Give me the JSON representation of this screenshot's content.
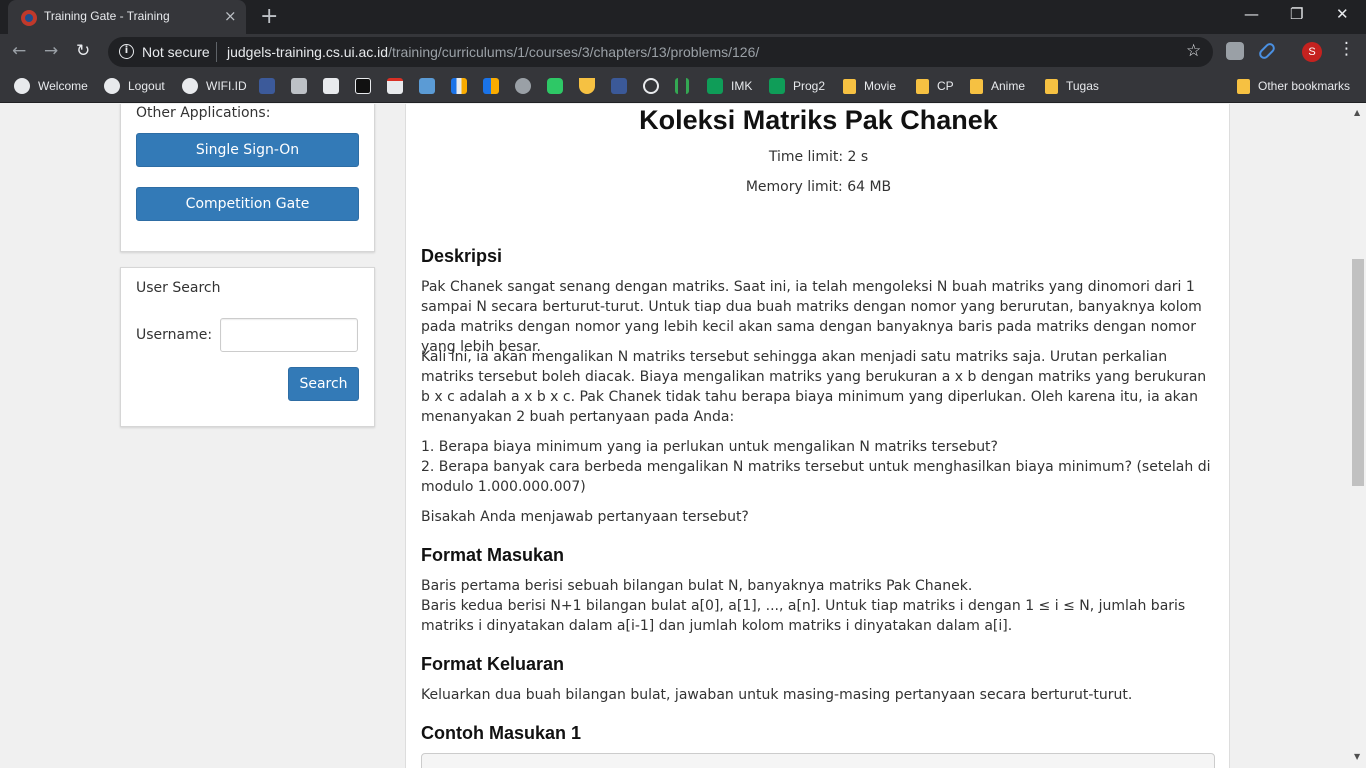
{
  "browser": {
    "tab_title": "Training Gate - Training",
    "tab_close": "×",
    "new_tab": "+",
    "window_controls": {
      "minimize": "—",
      "restore": "❐",
      "close": "✕"
    },
    "nav": {
      "back": "←",
      "forward": "→",
      "reload": "↻"
    },
    "security_label": "Not secure",
    "url_host": "judgels-training.cs.ui.ac.id",
    "url_path": "/training/curriculums/1/courses/3/chapters/13/problems/126/",
    "profile_initial": "S",
    "star": "☆",
    "menu": "⋮"
  },
  "bookmarks": [
    {
      "label": "Welcome"
    },
    {
      "label": "Logout"
    },
    {
      "label": "WIFI.ID"
    },
    {
      "label": "IMK"
    },
    {
      "label": "Prog2"
    },
    {
      "label": "Movie"
    },
    {
      "label": "CP"
    },
    {
      "label": "Anime"
    },
    {
      "label": "Tugas"
    },
    {
      "label": "Other bookmarks"
    }
  ],
  "sidebar": {
    "other_apps_label": "Other Applications:",
    "sso_button": "Single Sign-On",
    "competition_button": "Competition Gate",
    "user_search_title": "User Search",
    "username_label": "Username:",
    "username_value": "",
    "search_button": "Search"
  },
  "problem": {
    "title": "Koleksi Matriks Pak Chanek",
    "time_limit": "Time limit: 2 s",
    "memory_limit": "Memory limit: 64 MB",
    "desc_heading": "Deskripsi",
    "desc_p1": "Pak Chanek sangat senang dengan matriks. Saat ini, ia telah mengoleksi N buah matriks yang dinomori dari 1 sampai N secara berturut-turut. Untuk tiap dua buah matriks dengan nomor yang berurutan, banyaknya kolom pada matriks dengan nomor yang lebih kecil akan sama dengan banyaknya baris pada matriks dengan nomor yang lebih besar.",
    "desc_p2": "Kali ini, ia akan mengalikan N matriks tersebut sehingga akan menjadi satu matriks saja. Urutan perkalian matriks tersebut boleh diacak. Biaya mengalikan matriks yang berukuran a x b dengan matriks yang berukuran b x c adalah a x b x c. Pak Chanek tidak tahu berapa biaya minimum yang diperlukan. Oleh karena itu, ia akan menanyakan 2 buah pertanyaan pada Anda:",
    "question_1": "1. Berapa biaya minimum yang ia perlukan untuk mengalikan N matriks tersebut?",
    "question_2": "2. Berapa banyak cara berbeda mengalikan N matriks tersebut untuk menghasilkan biaya minimum? (setelah di modulo 1.000.000.007)",
    "desc_p3": "Bisakah Anda menjawab pertanyaan tersebut?",
    "input_heading": "Format Masukan",
    "input_line1": "Baris pertama berisi sebuah bilangan bulat N, banyaknya matriks Pak Chanek.",
    "input_line2": "Baris kedua berisi N+1 bilangan bulat a[0], a[1], ..., a[n]. Untuk tiap matriks i dengan 1 ≤ i ≤ N, jumlah baris matriks i dinyatakan dalam a[i-1] dan jumlah kolom matriks i dinyatakan dalam a[i].",
    "output_heading": "Format Keluaran",
    "output_text": "Keluarkan dua buah bilangan bulat, jawaban untuk masing-masing pertanyaan secara berturut-turut.",
    "sample_heading": "Contoh Masukan 1"
  }
}
